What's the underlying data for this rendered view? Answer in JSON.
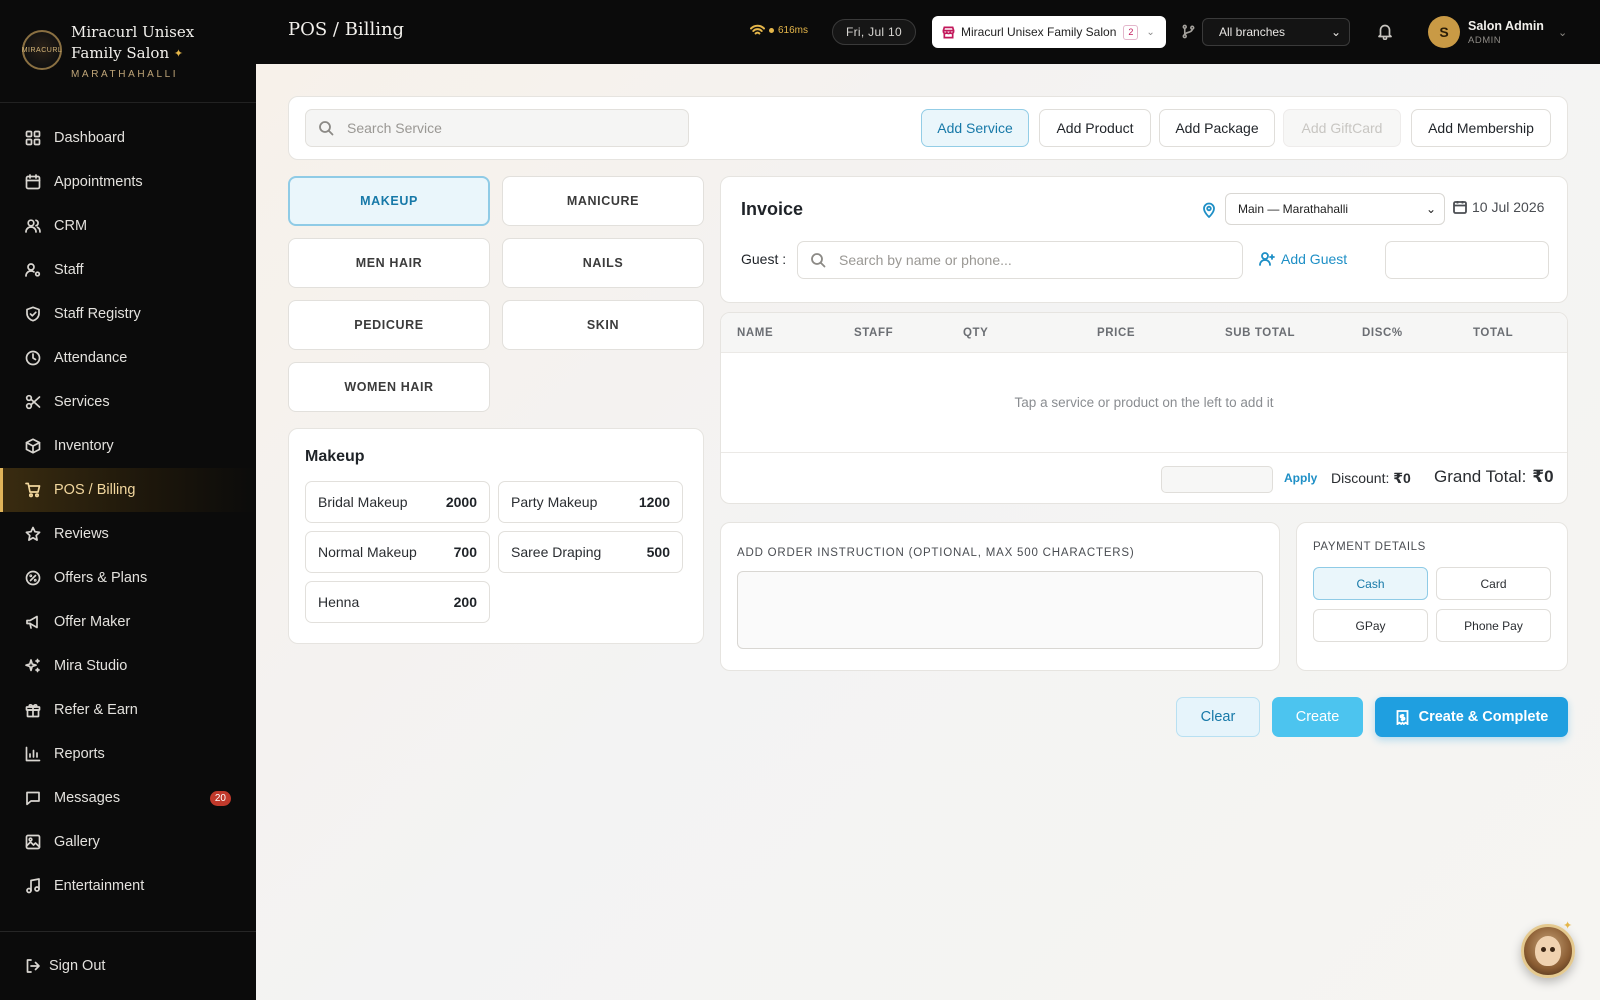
{
  "brand": {
    "name": "Miracurl Unisex Family Salon",
    "location": "MARATHAHALLI",
    "logo_text": "MIRACURL"
  },
  "sidebar": {
    "items": [
      {
        "label": "Dashboard",
        "icon": "dashboard-icon"
      },
      {
        "label": "Appointments",
        "icon": "calendar-icon"
      },
      {
        "label": "CRM",
        "icon": "users-icon"
      },
      {
        "label": "Staff",
        "icon": "user-cog-icon"
      },
      {
        "label": "Staff Registry",
        "icon": "shield-icon"
      },
      {
        "label": "Attendance",
        "icon": "clock-icon"
      },
      {
        "label": "Services",
        "icon": "scissors-icon"
      },
      {
        "label": "Inventory",
        "icon": "box-icon"
      },
      {
        "label": "POS / Billing",
        "icon": "cart-icon",
        "active": true
      },
      {
        "label": "Reviews",
        "icon": "star-icon"
      },
      {
        "label": "Offers & Plans",
        "icon": "percent-badge-icon"
      },
      {
        "label": "Offer Maker",
        "icon": "megaphone-icon"
      },
      {
        "label": "Mira Studio",
        "icon": "sparkles-icon"
      },
      {
        "label": "Refer & Earn",
        "icon": "gift-icon"
      },
      {
        "label": "Reports",
        "icon": "bar-chart-icon"
      },
      {
        "label": "Messages",
        "icon": "message-icon",
        "badge": "20"
      },
      {
        "label": "Gallery",
        "icon": "image-icon"
      },
      {
        "label": "Entertainment",
        "icon": "music-icon"
      }
    ],
    "sign_out": "Sign Out"
  },
  "topbar": {
    "title": "POS / Billing",
    "latency": "616ms",
    "date": "Fri, Jul 10",
    "salon": "Miracurl Unisex Family Salon",
    "salon_count": "2",
    "branch_filter": "All branches",
    "user_name": "Salon Admin",
    "user_role": "ADMIN",
    "user_initial": "S"
  },
  "toolbar": {
    "search_placeholder": "Search Service",
    "add_service": "Add Service",
    "add_product": "Add Product",
    "add_package": "Add Package",
    "add_giftcard": "Add GiftCard",
    "add_membership": "Add Membership"
  },
  "categories": [
    "MAKEUP",
    "MANICURE",
    "MEN HAIR",
    "NAILS",
    "PEDICURE",
    "SKIN",
    "WOMEN HAIR"
  ],
  "services": {
    "title": "Makeup",
    "items": [
      {
        "name": "Bridal Makeup",
        "price": "2000"
      },
      {
        "name": "Party Makeup",
        "price": "1200"
      },
      {
        "name": "Normal Makeup",
        "price": "700"
      },
      {
        "name": "Saree Draping",
        "price": "500"
      },
      {
        "name": "Henna",
        "price": "200"
      }
    ]
  },
  "invoice": {
    "title": "Invoice",
    "branch": "Main — Marathahalli",
    "date": "10 Jul 2026",
    "guest_label": "Guest :",
    "guest_placeholder": "Search by name or phone...",
    "add_guest": "Add Guest",
    "columns": [
      "NAME",
      "STAFF",
      "QTY",
      "PRICE",
      "SUB TOTAL",
      "DISC%",
      "TOTAL"
    ],
    "empty_message": "Tap a service or product on the left to add it",
    "apply": "Apply",
    "discount_label": "Discount:",
    "discount_value": "₹0",
    "grand_total_label": "Grand Total:",
    "grand_total_value": "₹0"
  },
  "instructions": {
    "label": "ADD ORDER INSTRUCTION (OPTIONAL, MAX 500 CHARACTERS)"
  },
  "payment": {
    "label": "PAYMENT DETAILS",
    "methods": [
      "Cash",
      "Card",
      "GPay",
      "Phone Pay"
    ],
    "selected": "Cash"
  },
  "actions": {
    "clear": "Clear",
    "create": "Create",
    "create_complete": "Create & Complete"
  },
  "colors": {
    "accent": "#1f9fe0",
    "gold": "#e0b45a",
    "sidebar_bg": "#0b0b0b",
    "active_bg": "#eaf6fb"
  }
}
